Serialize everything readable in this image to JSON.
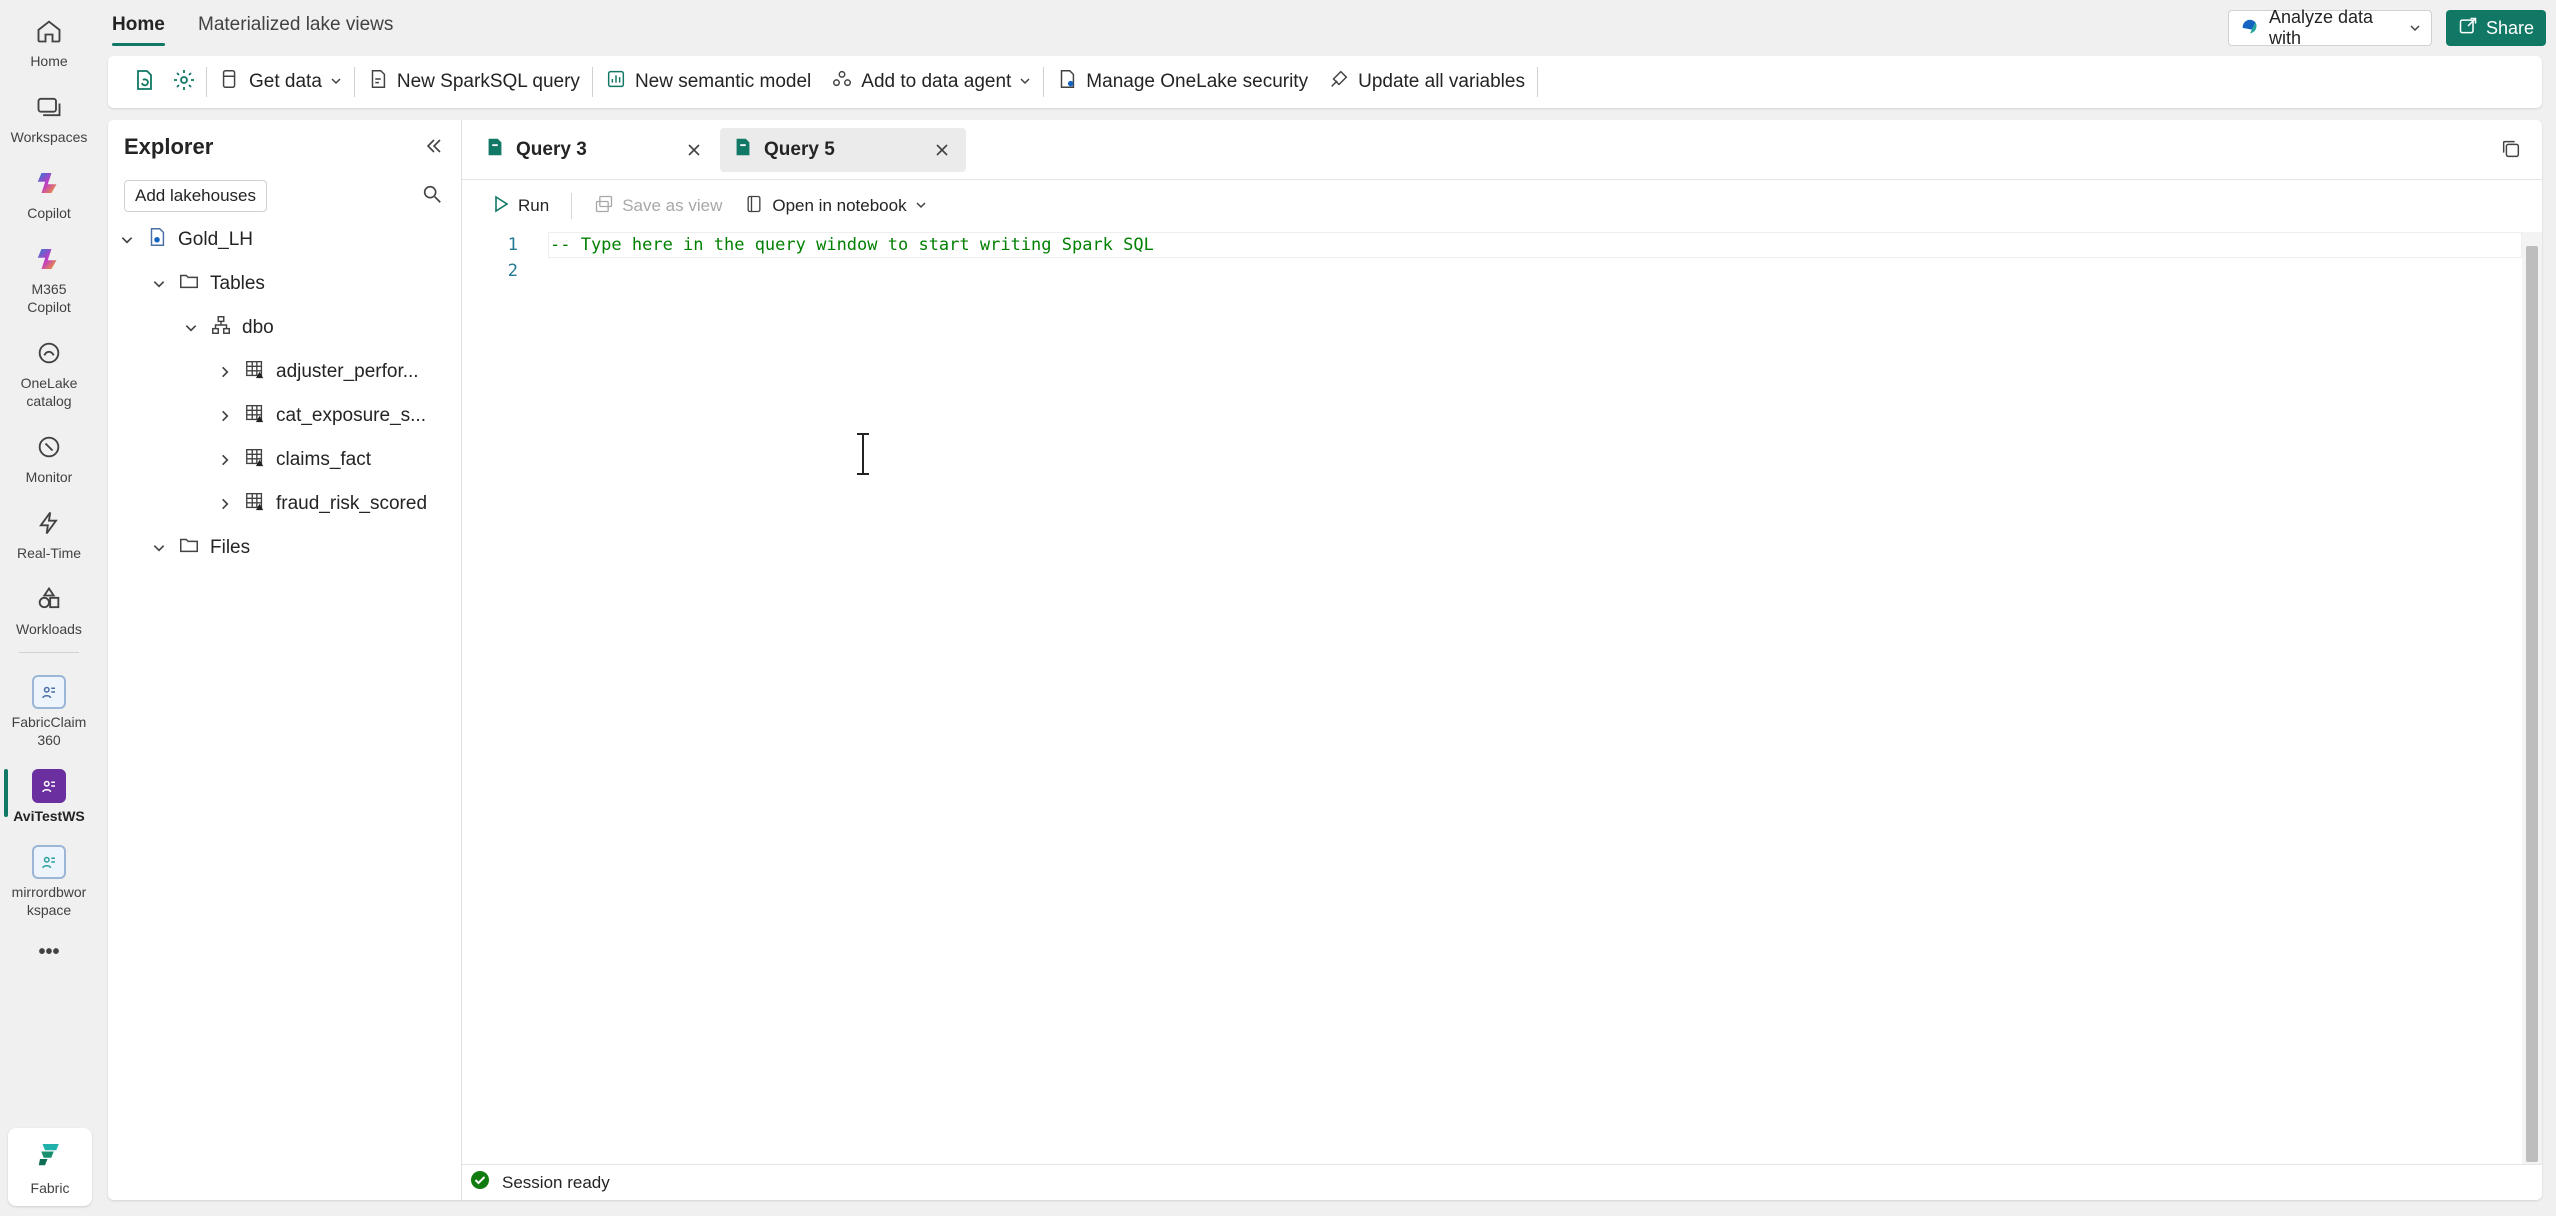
{
  "rail": {
    "items": [
      {
        "label": "Home",
        "icon": "home-icon"
      },
      {
        "label": "Workspaces",
        "icon": "workspaces-icon"
      },
      {
        "label": "Copilot",
        "icon": "copilot-icon"
      },
      {
        "label": "M365\nCopilot",
        "icon": "m365-copilot-icon"
      },
      {
        "label": "OneLake\ncatalog",
        "icon": "onelake-catalog-icon"
      },
      {
        "label": "Monitor",
        "icon": "monitor-icon"
      },
      {
        "label": "Real-Time",
        "icon": "real-time-icon"
      },
      {
        "label": "Workloads",
        "icon": "workloads-icon"
      },
      {
        "label": "FabricClaim\n360",
        "icon": "workspace-icon"
      },
      {
        "label": "AviTestWS",
        "icon": "workspace-icon"
      },
      {
        "label": "mirrordbwor\nkspace",
        "icon": "workspace-icon"
      }
    ],
    "more": "•••",
    "fabric_label": "Fabric"
  },
  "topbar": {
    "tabs": [
      "Home",
      "Materialized lake views"
    ],
    "analyze_label": "Analyze data with",
    "share_label": "Share"
  },
  "ribbon": {
    "get_data": "Get data",
    "new_sparksql": "New SparkSQL query",
    "new_semantic": "New semantic model",
    "add_agent": "Add to data agent",
    "manage_security": "Manage OneLake security",
    "update_vars": "Update all variables"
  },
  "explorer": {
    "title": "Explorer",
    "add_lakehouses": "Add lakehouses",
    "lakehouse": "Gold_LH",
    "tables_folder": "Tables",
    "schema": "dbo",
    "tables": [
      "adjuster_perfor...",
      "cat_exposure_s...",
      "claims_fact",
      "fraud_risk_scored"
    ],
    "files_folder": "Files"
  },
  "editor": {
    "tabs": [
      "Query 3",
      "Query 5"
    ],
    "toolbar": {
      "run": "Run",
      "save_as_view": "Save as view",
      "open_notebook": "Open in notebook"
    },
    "lines": [
      {
        "num": "1",
        "text": "-- Type here in the query window to start writing Spark SQL"
      },
      {
        "num": "2",
        "text": ""
      }
    ],
    "status": "Session ready"
  },
  "colors": {
    "accent": "#117865",
    "comment": "#008000",
    "line_number": "#237893",
    "status_ok": "#107c10"
  }
}
